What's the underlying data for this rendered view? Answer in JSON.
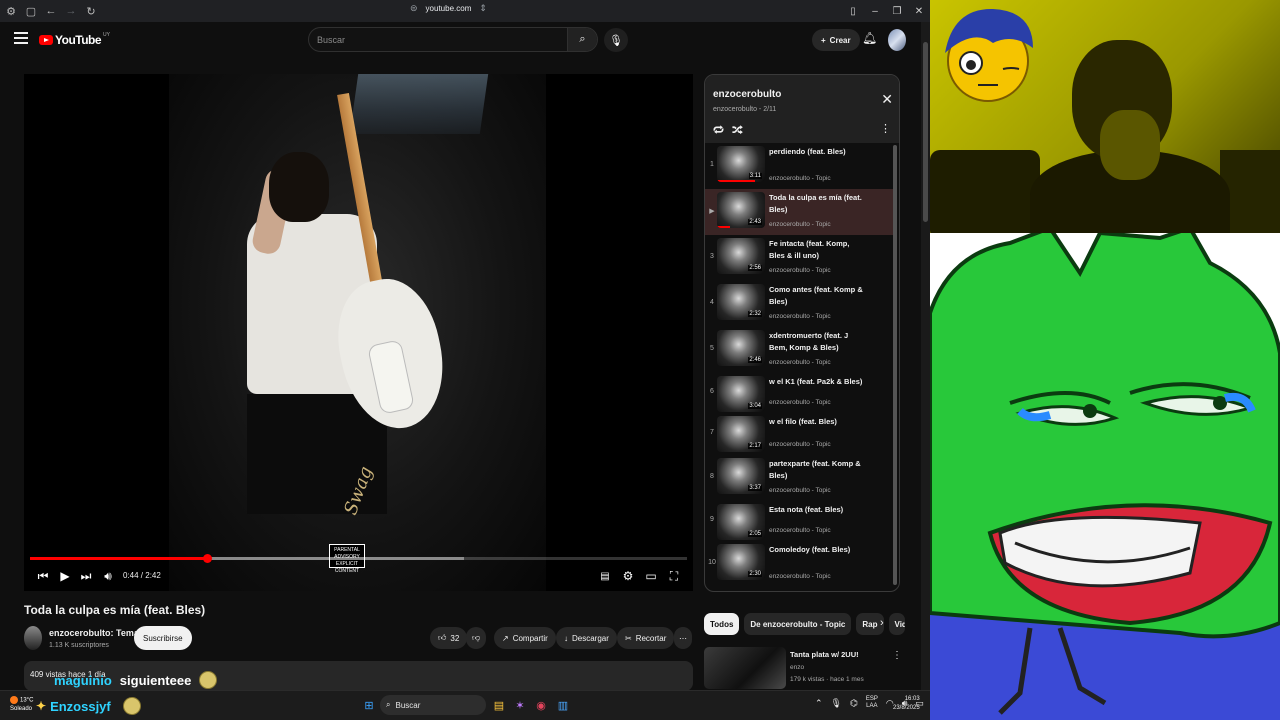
{
  "browser": {
    "url": "youtube.com"
  },
  "header": {
    "logo_text": "YouTube",
    "logo_country": "UY",
    "search_placeholder": "Buscar",
    "create_label": "Crear"
  },
  "player": {
    "time_display": "0:44 / 2:42",
    "progress": 0.27,
    "buffered": 0.66,
    "advisory_text": "PARENTAL ADVISORY EXPLICIT CONTENT",
    "signature_text": "Swag"
  },
  "video": {
    "title": "Toda la culpa es mía (feat. Bles)",
    "channel_name": "enzocerobulto: Tema",
    "subscribers": "1.13 K suscriptores",
    "subscribe_label": "Suscribirse",
    "likes": "32",
    "share_label": "Compartir",
    "download_label": "Descargar",
    "clip_label": "Recortar",
    "description_preview": "409 vistas hace 1 día"
  },
  "playlist": {
    "title": "enzocerobulto",
    "subtitle": "enzocerobulto - 2/11",
    "items": [
      {
        "index": "1",
        "name": "perdiendo (feat. Bles)",
        "channel": "enzocerobulto - Topic",
        "duration": "3:11"
      },
      {
        "index": "▶",
        "name": "Toda la culpa es mía (feat. Bles)",
        "channel": "enzocerobulto - Topic",
        "duration": "2:43"
      },
      {
        "index": "3",
        "name": "Fe intacta (feat. Komp, Bles & ill uno)",
        "channel": "enzocerobulto - Topic",
        "duration": "2:56"
      },
      {
        "index": "4",
        "name": "Como antes (feat. Komp & Bles)",
        "channel": "enzocerobulto - Topic",
        "duration": "2:32"
      },
      {
        "index": "5",
        "name": "xdentromuerto (feat. J Bem, Komp & Bles)",
        "channel": "enzocerobulto - Topic",
        "duration": "2:46"
      },
      {
        "index": "6",
        "name": "w el K1 (feat. Pa2k & Bles)",
        "channel": "enzocerobulto - Topic",
        "duration": "3:04"
      },
      {
        "index": "7",
        "name": "w el filo (feat. Bles)",
        "channel": "enzocerobulto - Topic",
        "duration": "2:17"
      },
      {
        "index": "8",
        "name": "partexparte (feat. Komp & Bles)",
        "channel": "enzocerobulto - Topic",
        "duration": "3:37"
      },
      {
        "index": "9",
        "name": "Esta nota (feat. Bles)",
        "channel": "enzocerobulto - Topic",
        "duration": "2:05"
      },
      {
        "index": "10",
        "name": "Comoledoy (feat. Bles)",
        "channel": "enzocerobulto - Topic",
        "duration": "2:30"
      }
    ]
  },
  "chips": [
    "Todos",
    "De enzocerobulto - Topic",
    "Rap",
    "Vid"
  ],
  "recommendation": {
    "title": "Tanta plata w/ 2UU!",
    "channel": "enzo",
    "meta": "179 k vistas · hace 1 mes"
  },
  "chat": [
    {
      "user": "maguinio",
      "message": "siguienteee"
    },
    {
      "user": "Enzossjyf",
      "message": ""
    }
  ],
  "taskbar": {
    "weather_temp": "13°C",
    "weather_desc": "Soleado",
    "search_label": "Buscar",
    "lang_top": "ESP",
    "lang_bottom": "LAA",
    "time": "16:03",
    "date": "23/8/2025"
  }
}
